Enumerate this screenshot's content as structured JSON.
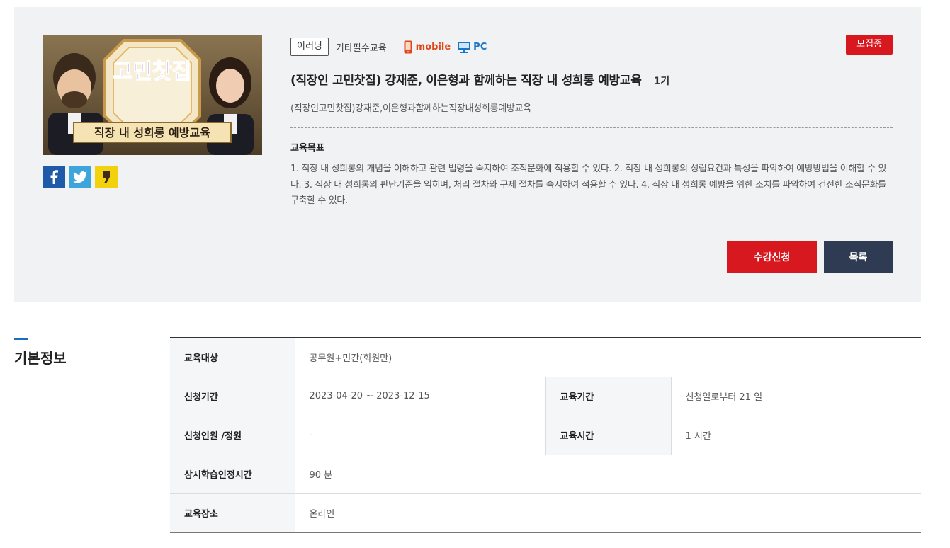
{
  "course": {
    "status_badge": "모집중",
    "type_tag": "이러닝",
    "category": "기타필수교육",
    "device_mobile": "mobile",
    "device_pc": "PC",
    "title": "(직장인 고민찻집) 강재준, 이은형과 함께하는 직장 내 성희롱 예방교육",
    "term": "1기",
    "subtitle": "(직장인고민찻집)강재준,이은형과함께하는직장내성희롱예방교육",
    "goal_heading": "교육목표",
    "goal_text": "1. 직장 내 성희롱의 개념을 이해하고 관련 법령을 숙지하여 조직문화에 적용할 수 있다. 2. 직장 내 성희롱의 성립요건과 특성을 파악하여 예방방법을 이해할 수 있다. 3. 직장 내 성희롱의 판단기준을 익히며, 처리 절차와 구제 절차를 숙지하여 적용할 수 있다. 4. 직장 내 성희롱 예방을 위한 조치를 파악하여 건전한 조직문화를 구축할 수 있다.",
    "thumbnail_caption": "직장 내 성희롱 예방교육",
    "thumbnail_logo": "고민찻집"
  },
  "share": {
    "facebook_icon": "facebook-icon",
    "twitter_icon": "twitter-icon",
    "kakao_icon": "kakaostory-icon"
  },
  "actions": {
    "apply_label": "수강신청",
    "list_label": "목록"
  },
  "basic_info": {
    "section_title": "기본정보",
    "target_label": "교육대상",
    "target_value": "공무원+민간(회원만)",
    "apply_period_label": "신청기간",
    "apply_period_value": "2023-04-20 ~ 2023-12-15",
    "edu_period_label": "교육기간",
    "edu_period_value": "신청일로부터 21 일",
    "applicants_label": "신청인원 /정원",
    "applicants_value": "-",
    "edu_hours_label": "교육시간",
    "edu_hours_value": "1 시간",
    "recognized_label": "상시학습인정시간",
    "recognized_value": "90 분",
    "place_label": "교육장소",
    "place_value": "온라인"
  },
  "colors": {
    "accent_red": "#d7191f",
    "navy": "#2f3b52",
    "panel_bg": "#f1f2f4",
    "section_blue": "#1a6fc0"
  }
}
